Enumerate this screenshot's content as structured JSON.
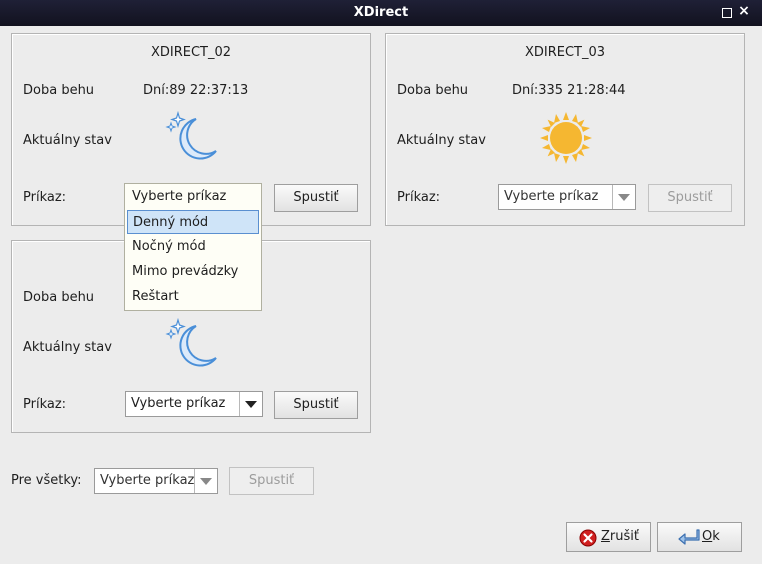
{
  "window": {
    "title": "XDirect"
  },
  "panels": [
    {
      "title": "XDIRECT_02",
      "runtime_label": "Doba behu",
      "runtime_value": "Dní:89 22:37:13",
      "state_label": "Aktuálny stav",
      "state_icon": "moon-icon",
      "command_label": "Príkaz:",
      "combo_value": "Vyberte príkaz",
      "run_label": "Spustiť"
    },
    {
      "title": "XDIRECT_03",
      "runtime_label": "Doba behu",
      "runtime_value": "Dní:335 21:28:44",
      "state_label": "Aktuálny stav",
      "state_icon": "sun-icon",
      "command_label": "Príkaz:",
      "combo_value": "Vyberte príkaz",
      "run_label": "Spustiť"
    },
    {
      "title": "",
      "runtime_label": "Doba behu",
      "runtime_value": "",
      "state_label": "Aktuálny stav",
      "state_icon": "moon-icon",
      "command_label": "Príkaz:",
      "combo_value": "Vyberte príkaz",
      "run_label": "Spustiť"
    }
  ],
  "dropdown": {
    "items": [
      "Vyberte príkaz",
      "Denný mód",
      "Nočný mód",
      "Mimo prevádzky",
      "Reštart"
    ],
    "highlighted_index": 1
  },
  "all": {
    "label": "Pre všetky:",
    "combo_value": "Vyberte príkaz",
    "run_label": "Spustiť"
  },
  "footer": {
    "cancel_prefix": "Z",
    "cancel_rest": "rušiť",
    "ok_prefix": "O",
    "ok_rest": "k"
  },
  "colors": {
    "titlebar": "#17172a",
    "moon": "#4a8fd8",
    "sun": "#f5b731",
    "cancel_icon": "#d02020"
  }
}
